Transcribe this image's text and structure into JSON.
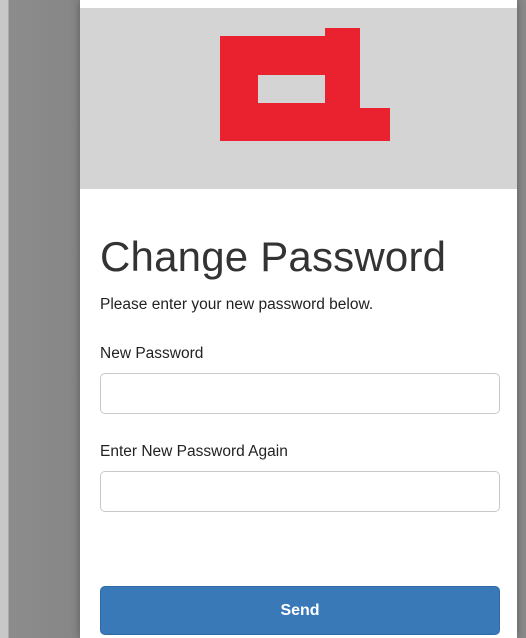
{
  "colors": {
    "logo_red": "#ea2230",
    "logo_background": "#d4d4d4",
    "button_blue": "#3a79b8",
    "backdrop_gray": "#868686"
  },
  "header": {
    "logo_icon": "brand-logo-icon"
  },
  "form": {
    "title": "Change Password",
    "subtitle": "Please enter your new password below.",
    "new_password_label": "New Password",
    "new_password_value": "",
    "confirm_password_label": "Enter New Password Again",
    "confirm_password_value": "",
    "submit_label": "Send"
  }
}
